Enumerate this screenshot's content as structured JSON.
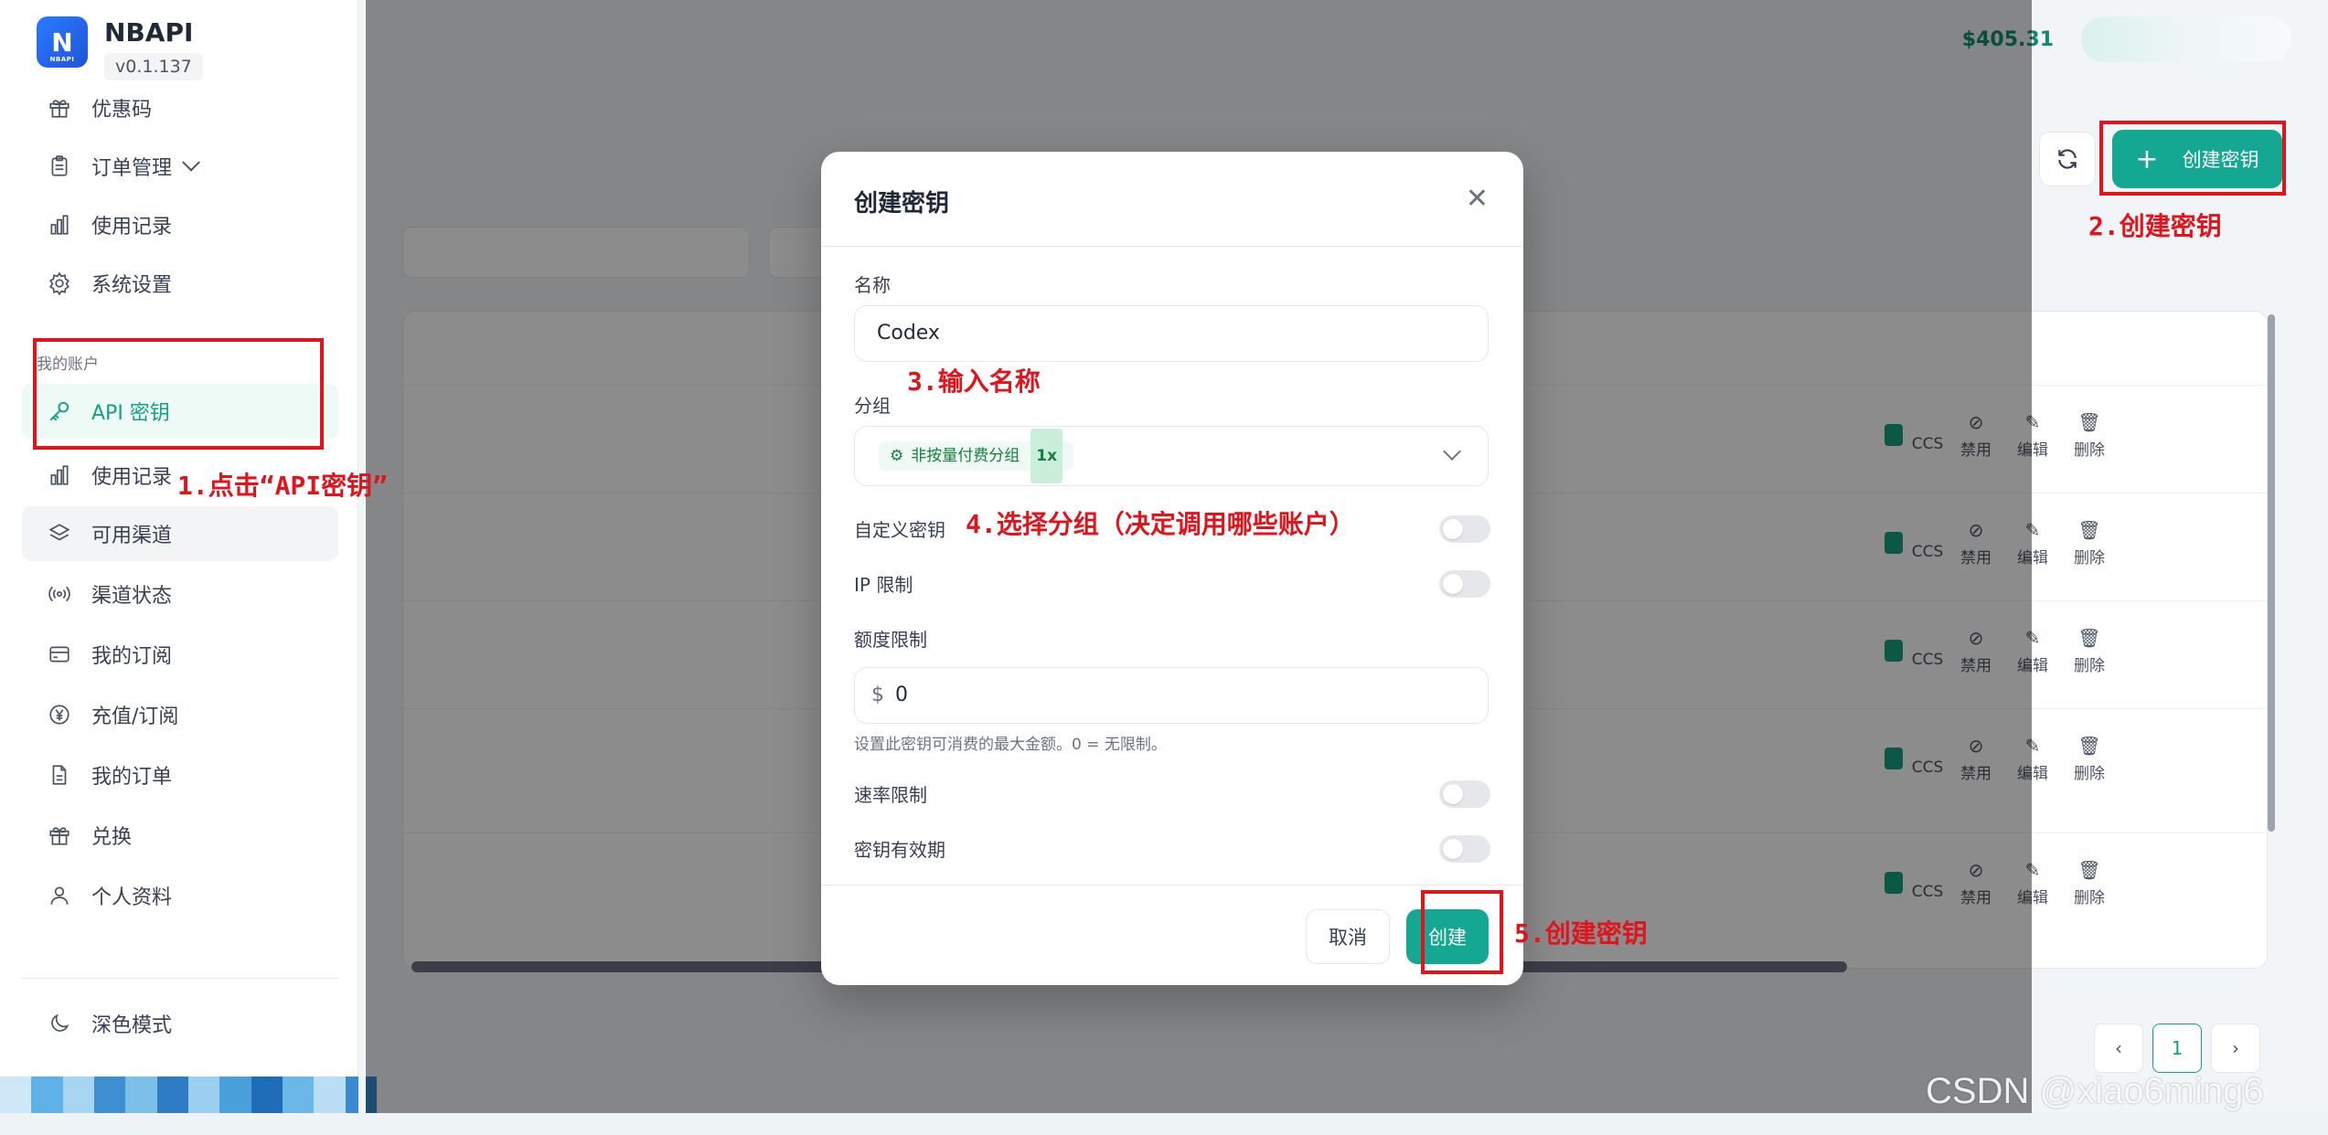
{
  "app": {
    "name": "NBAPI",
    "version": "v0.1.137"
  },
  "sidebar": {
    "section_label": "我的账户",
    "items": [
      {
        "label": "优惠码",
        "icon": "gift-icon"
      },
      {
        "label": "订单管理",
        "icon": "clipboard-icon"
      },
      {
        "label": "使用记录",
        "icon": "bar-chart-icon"
      },
      {
        "label": "系统设置",
        "icon": "gear-icon"
      },
      {
        "label": "API 密钥",
        "icon": "key-icon"
      },
      {
        "label": "使用记录",
        "icon": "bar-chart-icon"
      },
      {
        "label": "可用渠道",
        "icon": "layers-icon"
      },
      {
        "label": "渠道状态",
        "icon": "signal-icon"
      },
      {
        "label": "我的订阅",
        "icon": "card-icon"
      },
      {
        "label": "充值/订阅",
        "icon": "yen-icon"
      },
      {
        "label": "我的订单",
        "icon": "document-icon"
      },
      {
        "label": "兑换",
        "icon": "gift-icon"
      },
      {
        "label": "个人资料",
        "icon": "user-icon"
      }
    ],
    "dark_mode": "深色模式"
  },
  "header": {
    "balance": "$405.31"
  },
  "main": {
    "create_button": "创建密钥",
    "rows": [
      {
        "actions": [
          "CCS",
          "禁用",
          "编辑",
          "删除"
        ]
      },
      {
        "actions": [
          "CCS",
          "禁用",
          "编辑",
          "删除"
        ]
      },
      {
        "actions": [
          "CCS",
          "禁用",
          "编辑",
          "删除"
        ]
      },
      {
        "actions": [
          "CCS",
          "禁用",
          "编辑",
          "删除"
        ]
      },
      {
        "actions": [
          "CCS",
          "禁用",
          "编辑",
          "删除"
        ]
      }
    ],
    "pagination": {
      "current": "1"
    }
  },
  "modal": {
    "title": "创建密钥",
    "name_label": "名称",
    "name_value": "Codex",
    "group_label": "分组",
    "group_value": "非按量付费分组",
    "group_multiplier": "1x",
    "custom_key_label": "自定义密钥",
    "ip_limit_label": "IP 限制",
    "quota_label": "额度限制",
    "quota_currency": "$",
    "quota_value": "0",
    "quota_hint": "设置此密钥可消费的最大金额。0 = 无限制。",
    "rate_limit_label": "速率限制",
    "expiry_label": "密钥有效期",
    "cancel": "取消",
    "create": "创建"
  },
  "annotations": {
    "step1": "1.点击“API密钥”",
    "step2": "2.创建密钥",
    "step3": "3.输入名称",
    "step4": "4.选择分组（决定调用哪些账户）",
    "step5": "5.创建密钥",
    "color": "#e0141c"
  },
  "watermark": "CSDN @xiao6ming6"
}
